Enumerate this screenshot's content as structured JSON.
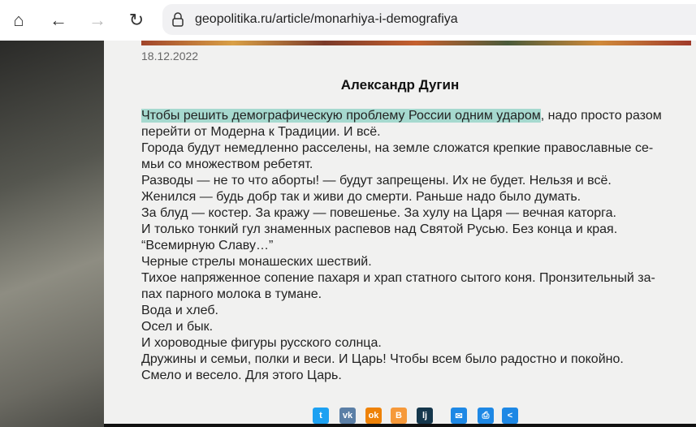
{
  "browser": {
    "url": "geopolitika.ru/article/monarhiya-i-demografiya"
  },
  "article": {
    "date": "18.12.2022",
    "author": "Александр Дугин",
    "highlighted": "Чтобы решить демографическую проблему России одним ударом",
    "lines": [
      ", надо просто разом",
      "перейти от Модерна к Традиции. И всё.",
      "Города будут немедленно расселены, на земле сложатся крепкие православные се-",
      "мьи со множеством ребетят.",
      "Разводы — не то что аборты! — будут запрещены. Их не будет. Нельзя и всё.",
      "Женился — будь добр так и живи до смерти. Раньше надо было думать.",
      "За блуд — костер. За кражу — повешенье. За хулу на Царя — вечная каторга.",
      "И только тонкий гул знаменных распевов над Святой Русью. Без конца и края.",
      "“Всемирную Славу…”",
      "Черные стрелы монашеских шествий.",
      "Тихое напряженное сопение пахаря и храп статного сытого коня. Пронзительный за-",
      "пах парного молока в тумане.",
      "Вода и хлеб.",
      "Осел и бык.",
      "И хороводные фигуры русского солнца.",
      "Дружины и семьи, полки и веси. И Царь! Чтобы всем было радостно и покойно.",
      "Смело и весело. Для этого Царь."
    ]
  },
  "share": [
    {
      "icon": "twitter-icon",
      "glyph": "t",
      "color": "#1da1f2"
    },
    {
      "icon": "vk-icon",
      "glyph": "vk",
      "color": "#5b7fa6"
    },
    {
      "icon": "odnoklassniki-icon",
      "glyph": "ok",
      "color": "#ee8208"
    },
    {
      "icon": "blogger-icon",
      "glyph": "B",
      "color": "#f6993a"
    },
    {
      "icon": "livejournal-icon",
      "glyph": "lj",
      "color": "#15374c"
    },
    {
      "icon": "email-icon",
      "glyph": "✉",
      "color": "#1e88e5"
    },
    {
      "icon": "print-icon",
      "glyph": "⎙",
      "color": "#1e88e5"
    },
    {
      "icon": "share-icon",
      "glyph": "<",
      "color": "#1e88e5"
    }
  ]
}
